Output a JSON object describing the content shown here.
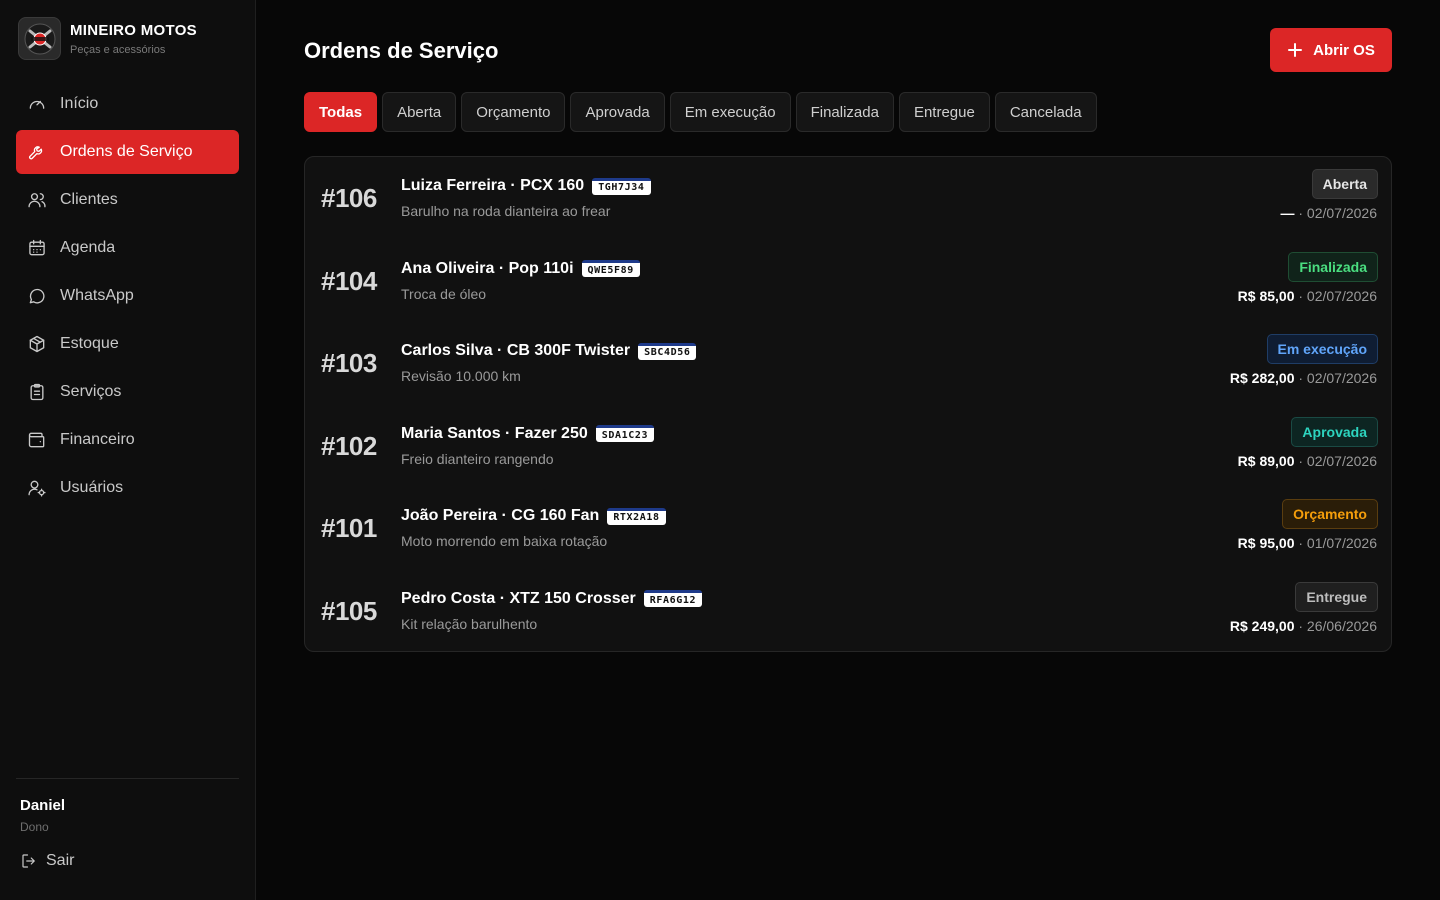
{
  "brand": {
    "name": "MINEIRO MOTOS",
    "subtitle": "Peças e acessórios"
  },
  "nav": [
    {
      "label": "Início",
      "icon": "gauge-icon"
    },
    {
      "label": "Ordens de Serviço",
      "icon": "wrench-icon",
      "active": true
    },
    {
      "label": "Clientes",
      "icon": "users-icon"
    },
    {
      "label": "Agenda",
      "icon": "calendar-icon"
    },
    {
      "label": "WhatsApp",
      "icon": "chat-icon"
    },
    {
      "label": "Estoque",
      "icon": "package-icon"
    },
    {
      "label": "Serviços",
      "icon": "clipboard-icon"
    },
    {
      "label": "Financeiro",
      "icon": "wallet-icon"
    },
    {
      "label": "Usuários",
      "icon": "user-cog-icon"
    }
  ],
  "user": {
    "name": "Daniel",
    "role": "Dono",
    "logout_label": "Sair"
  },
  "page": {
    "title": "Ordens de Serviço",
    "new_button_label": "Abrir OS"
  },
  "tabs": [
    "Todas",
    "Aberta",
    "Orçamento",
    "Aprovada",
    "Em execução",
    "Finalizada",
    "Entregue",
    "Cancelada"
  ],
  "active_tab": "Todas",
  "colors": {
    "accent": "#dc2626",
    "status": {
      "Aberta": {
        "fg": "#e5e5e5",
        "bg": "#2a2a2a",
        "border": "#3a3a3a"
      },
      "Finalizada": {
        "fg": "#4ade80",
        "bg": "#10231a",
        "border": "#1f4d33"
      },
      "Em execução": {
        "fg": "#60a5fa",
        "bg": "#0f1d33",
        "border": "#1f3d66"
      },
      "Aprovada": {
        "fg": "#2dd4bf",
        "bg": "#0d2522",
        "border": "#1a4a44"
      },
      "Orçamento": {
        "fg": "#f59e0b",
        "bg": "#2a1d08",
        "border": "#5a3d0f"
      },
      "Entregue": {
        "fg": "#bdbdbd",
        "bg": "#1f1f1f",
        "border": "#3a3a3a"
      }
    }
  },
  "orders": [
    {
      "id": "#106",
      "name": "Luiza Ferreira · PCX 160",
      "plate": "TGH7J34",
      "desc": "Barulho na roda dianteira ao frear",
      "status": "Aberta",
      "price": "—",
      "date": "· 02/07/2026"
    },
    {
      "id": "#104",
      "name": "Ana Oliveira · Pop 110i",
      "plate": "QWE5F89",
      "desc": "Troca de óleo",
      "status": "Finalizada",
      "price": "R$ 85,00",
      "date": "· 02/07/2026"
    },
    {
      "id": "#103",
      "name": "Carlos Silva · CB 300F Twister",
      "plate": "SBC4D56",
      "desc": "Revisão 10.000 km",
      "status": "Em execução",
      "price": "R$ 282,00",
      "date": "· 02/07/2026"
    },
    {
      "id": "#102",
      "name": "Maria Santos · Fazer 250",
      "plate": "SDA1C23",
      "desc": "Freio dianteiro rangendo",
      "status": "Aprovada",
      "price": "R$ 89,00",
      "date": "· 02/07/2026"
    },
    {
      "id": "#101",
      "name": "João Pereira · CG 160 Fan",
      "plate": "RTX2A18",
      "desc": "Moto morrendo em baixa rotação",
      "status": "Orçamento",
      "price": "R$ 95,00",
      "date": "· 01/07/2026"
    },
    {
      "id": "#105",
      "name": "Pedro Costa · XTZ 150 Crosser",
      "plate": "RFA6G12",
      "desc": "Kit relação barulhento",
      "status": "Entregue",
      "price": "R$ 249,00",
      "date": "· 26/06/2026"
    }
  ]
}
